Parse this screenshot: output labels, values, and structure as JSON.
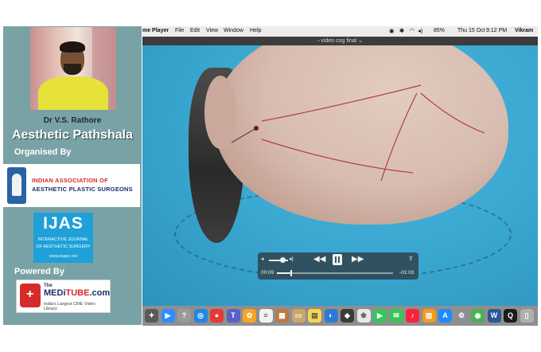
{
  "sidebar": {
    "speaker_name": "Dr V.S. Rathore",
    "brand_title": "Aesthetic Pathshala",
    "organised_label": "Organised By",
    "iaaps": {
      "line1": "INDIAN ASSOCIATION OF",
      "line2": "AESTHETIC PLASTIC SURGEONS"
    },
    "ijas": {
      "mark": "IJAS",
      "line1": "INTERACTIVE JOURNAL",
      "line2": "OF AESTHETIC SURGERY",
      "url": "www.iaaps.net"
    },
    "powered_label": "Powered By",
    "meditube": {
      "pre": "The",
      "word_a": "MEDi",
      "word_b": "TUBE",
      "word_c": ".com",
      "tagline": "India's Largest CME Video Library"
    }
  },
  "menubar": {
    "app_name": "me Player",
    "items": [
      "File",
      "Edit",
      "View",
      "Window",
      "Help"
    ],
    "battery": "85%",
    "date": "Thu 15 Oct",
    "time": "9:12 PM",
    "user": "Vikram"
  },
  "window": {
    "title": "video cog final"
  },
  "player": {
    "elapsed": "00:09",
    "remaining": "-01:03",
    "progress": 0.125,
    "volume": 0.7
  },
  "dock": {
    "icons": [
      {
        "name": "launchpad-icon",
        "color": "#5a5a5a",
        "glyph": "✦"
      },
      {
        "name": "zoom-icon",
        "color": "#2d8cff",
        "glyph": "▶"
      },
      {
        "name": "help-icon",
        "color": "#9a9a9a",
        "glyph": "?"
      },
      {
        "name": "safari-icon",
        "color": "#1e88e5",
        "glyph": "◎"
      },
      {
        "name": "chrome-icon",
        "color": "#e53935",
        "glyph": "●"
      },
      {
        "name": "teams-icon",
        "color": "#5b5fc7",
        "glyph": "T"
      },
      {
        "name": "kaleidoscope-icon",
        "color": "#f5a623",
        "glyph": "✿"
      },
      {
        "name": "notes-icon",
        "color": "#f2f2f2",
        "glyph": "≡"
      },
      {
        "name": "photo-icon",
        "color": "#b77b4a",
        "glyph": "▦"
      },
      {
        "name": "finder-folder-icon",
        "color": "#c9a66b",
        "glyph": "▭"
      },
      {
        "name": "stickies-icon",
        "color": "#f7d84a",
        "glyph": "▤"
      },
      {
        "name": "photo-booth-icon",
        "color": "#2e7bd6",
        "glyph": "◐"
      },
      {
        "name": "app-store-alt-icon",
        "color": "#3a3a3a",
        "glyph": "◆"
      },
      {
        "name": "photos-icon",
        "color": "#e8e8e8",
        "glyph": "❀"
      },
      {
        "name": "facetime-icon",
        "color": "#34c759",
        "glyph": "▶"
      },
      {
        "name": "messages-icon",
        "color": "#34c759",
        "glyph": "✉"
      },
      {
        "name": "music-icon",
        "color": "#fa233b",
        "glyph": "♪"
      },
      {
        "name": "books-icon",
        "color": "#f29c1f",
        "glyph": "▥"
      },
      {
        "name": "app-store-icon",
        "color": "#1a8cff",
        "glyph": "A"
      },
      {
        "name": "system-preferences-icon",
        "color": "#8e8e93",
        "glyph": "⚙"
      },
      {
        "name": "maps-icon",
        "color": "#4caf50",
        "glyph": "◉"
      },
      {
        "name": "word-icon",
        "color": "#2b579a",
        "glyph": "W"
      },
      {
        "name": "quicktime-icon",
        "color": "#1c1c1c",
        "glyph": "Q"
      },
      {
        "name": "trash-icon",
        "color": "#b0b0b0",
        "glyph": "▯"
      }
    ]
  }
}
